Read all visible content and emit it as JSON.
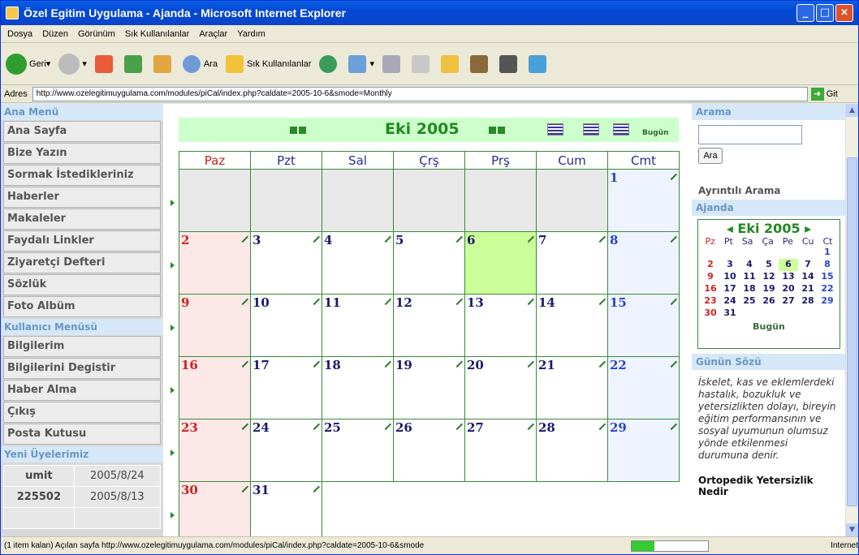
{
  "window": {
    "title": "Özel Egitim Uygulama - Ajanda - Microsoft Internet Explorer"
  },
  "menu": [
    "Dosya",
    "Düzen",
    "Görünüm",
    "Sık Kullanılanlar",
    "Araçlar",
    "Yardım"
  ],
  "toolbar": {
    "back": "Geri",
    "search": "Ara",
    "favorites": "Sık Kullanılanlar"
  },
  "address": {
    "label": "Adres",
    "url": "http://www.ozelegitimuygulama.com/modules/piCal/index.php?caldate=2005-10-6&smode=Monthly",
    "go": "Git"
  },
  "status": {
    "text": "(1 item kalan) Açılan sayfa http://www.ozelegitimuygulama.com/modules/piCal/index.php?caldate=2005-10-6&smode",
    "zone": "Internet"
  },
  "left": {
    "main_header": "Ana Menü",
    "main": [
      "Ana Sayfa",
      "Bize Yazın",
      "Sormak İstedikleriniz",
      "Haberler",
      "Makaleler",
      "Faydalı Linkler",
      "Ziyaretçi Defteri",
      "Sözlük",
      "Foto Albüm"
    ],
    "user_header": "Kullanıcı Menüsü",
    "user": [
      "Bilgilerim",
      "Bilgilerini Degistir",
      "Haber Alma",
      "Çıkış",
      "Posta Kutusu"
    ],
    "new_header": "Yeni Üyelerimiz",
    "new_members": [
      {
        "name": "umit",
        "date": "2005/8/24"
      },
      {
        "name": "225502",
        "date": "2005/8/13"
      }
    ]
  },
  "calendar": {
    "month": "Eki 2005",
    "today": "Bugün",
    "days": [
      "Paz",
      "Pzt",
      "Sal",
      "Çrş",
      "Prş",
      "Cum",
      "Cmt"
    ],
    "weeks": [
      [
        "",
        "",
        "",
        "",
        "",
        "",
        "1"
      ],
      [
        "2",
        "3",
        "4",
        "5",
        "6",
        "7",
        "8"
      ],
      [
        "9",
        "10",
        "11",
        "12",
        "13",
        "14",
        "15"
      ],
      [
        "16",
        "17",
        "18",
        "19",
        "20",
        "21",
        "22"
      ],
      [
        "23",
        "24",
        "25",
        "26",
        "27",
        "28",
        "29"
      ],
      [
        "30",
        "31",
        "",
        "",
        "",
        "",
        ""
      ]
    ],
    "today_date": "6"
  },
  "right": {
    "search_header": "Arama",
    "search_button": "Ara",
    "advanced": "Ayrıntılı Arama",
    "agenda_header": "Ajanda",
    "mini_month": "Eki 2005",
    "mini_days": [
      "Pz",
      "Pt",
      "Sa",
      "Ça",
      "Pe",
      "Cu",
      "Ct"
    ],
    "mini_today": "Bugün",
    "quote_header": "Günün Sözü",
    "quote": "İskelet, kas ve eklemlerdeki hastalık, bozukluk ve yetersizlikten dolayı, bireyin eğitim performansının ve sosyal uyumunun olumsuz yönde etkilenmesi durumuna denir.",
    "quote_title": "Ortopedik Yetersizlik Nedir"
  }
}
